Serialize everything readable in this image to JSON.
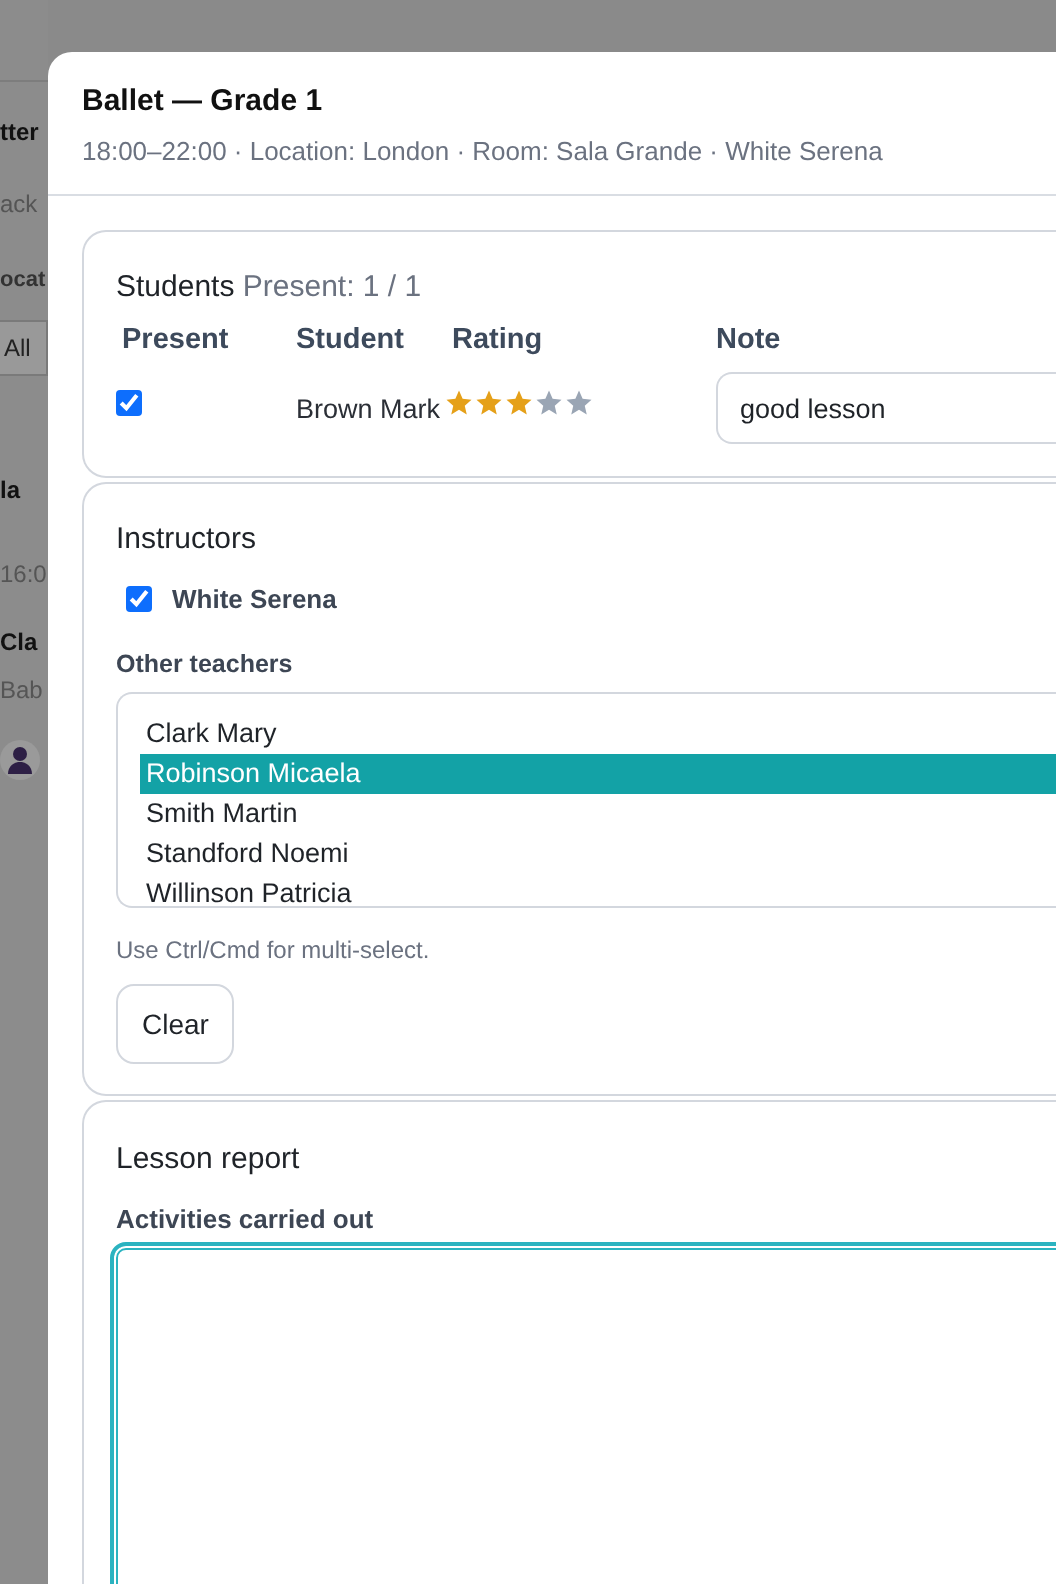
{
  "backdrop": {
    "fragments": [
      {
        "text": "tter",
        "kind": "heading"
      },
      {
        "text": "ack",
        "kind": "text"
      },
      {
        "text": "ocat",
        "kind": "label"
      },
      {
        "text": "All",
        "kind": "field"
      },
      {
        "text": "la",
        "kind": "heading"
      },
      {
        "text": "16:0",
        "kind": "text"
      },
      {
        "text": "Cla",
        "kind": "heading"
      },
      {
        "text": "Bab",
        "kind": "text"
      },
      {
        "kind": "avatar"
      }
    ]
  },
  "dialog": {
    "title": "Ballet — Grade 1",
    "subtitle": "18:00–22:00 · Location: London · Room: Sala Grande · White Serena"
  },
  "students": {
    "title": "Students",
    "summary": "Present: 1 / 1",
    "columns": [
      "Present",
      "Student",
      "Rating",
      "Note"
    ],
    "rows": [
      {
        "present": true,
        "name": "Brown Mark",
        "stars": 3,
        "note": "good lesson"
      }
    ]
  },
  "instructors": {
    "title": "Instructors",
    "assigned": [
      {
        "name": "White Serena",
        "checked": true
      }
    ],
    "other_label": "Other teachers",
    "other_teachers": [
      {
        "name": "Clark Mary",
        "selected": false
      },
      {
        "name": "Robinson Micaela",
        "selected": true
      },
      {
        "name": "Smith Martin",
        "selected": false
      },
      {
        "name": "Standford Noemi",
        "selected": false
      },
      {
        "name": "Willinson Patricia",
        "selected": false
      }
    ],
    "hint": "Use Ctrl/Cmd for multi-select.",
    "clear_button": "Clear"
  },
  "lesson_report": {
    "title": "Lesson report",
    "activities_label": "Activities carried out",
    "focused": true
  }
}
